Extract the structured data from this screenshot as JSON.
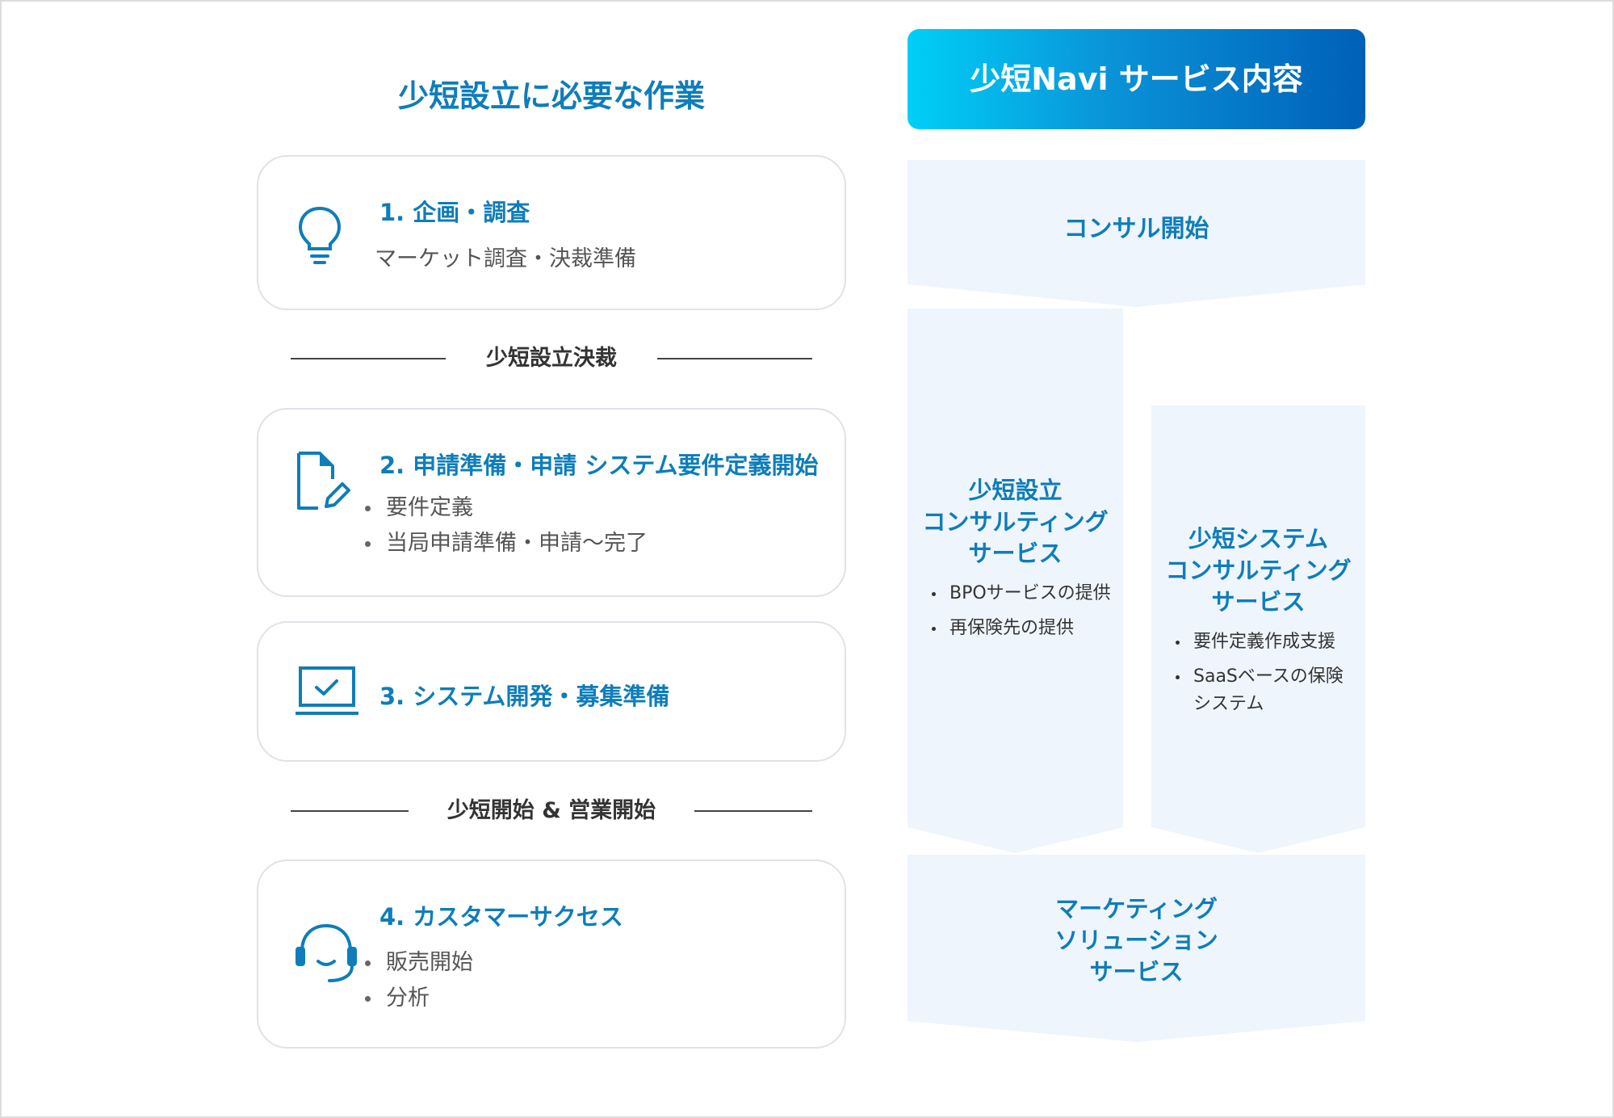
{
  "left": {
    "title": "少短設立に必要な作業",
    "steps": [
      {
        "title": "1. 企画・調査",
        "description": "マーケット調査・決裁準備"
      },
      {
        "title": "2. 申請準備・申請 システム要件定義開始",
        "items": [
          "要件定義",
          "当局申請準備・申請〜完了"
        ]
      },
      {
        "title": "3. システム開発・募集準備"
      },
      {
        "title": "4. カスタマーサクセス",
        "items": [
          "販売開始",
          "分析"
        ]
      }
    ],
    "milestones": [
      "少短設立決裁",
      "少短開始 & 営業開始"
    ]
  },
  "right": {
    "title": "少短Navi サービス内容",
    "consult_start": "コンサル開始",
    "setup_service": {
      "title_lines": [
        "少短設立",
        "コンサルティング",
        "サービス"
      ],
      "items": [
        "BPOサービスの提供",
        "再保険先の提供"
      ]
    },
    "system_service": {
      "title_lines": [
        "少短システム",
        "コンサルティング",
        "サービス"
      ],
      "items": [
        "要件定義作成支援",
        "SaaSベースの保険システム"
      ]
    },
    "marketing_service": {
      "title_lines": [
        "マーケティング",
        "ソリューション",
        "サービス"
      ]
    }
  },
  "colors": {
    "accent": "#0f7db9",
    "panel": "#eff5fd",
    "banner_start": "#00cff7",
    "banner_end": "#0060b8",
    "card_border": "#dfe3e8"
  }
}
